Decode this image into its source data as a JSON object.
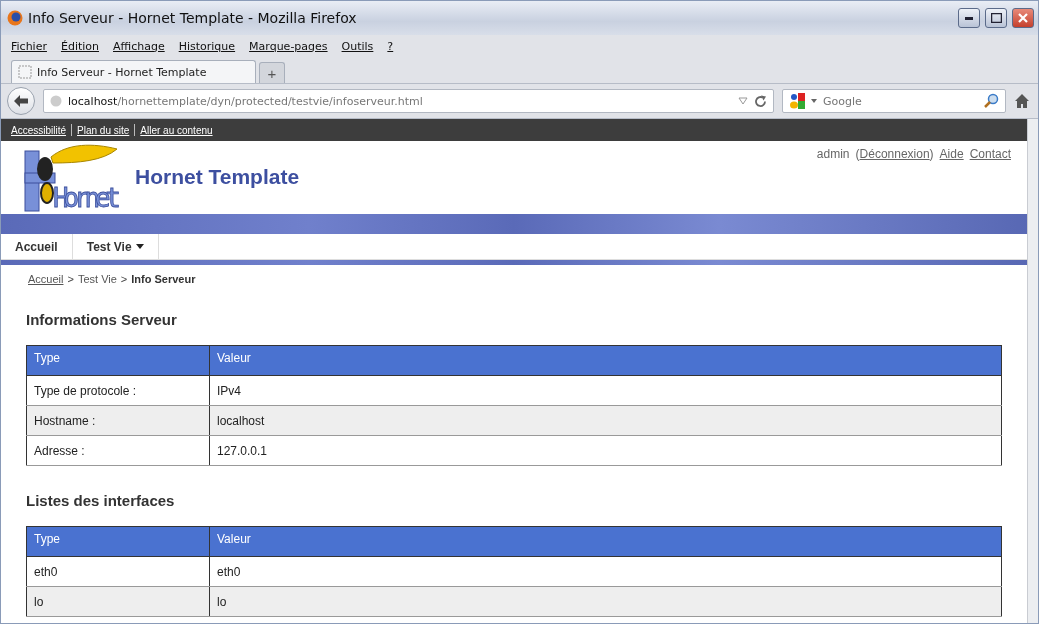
{
  "window": {
    "title": "Info Serveur - Hornet Template - Mozilla Firefox"
  },
  "menu": [
    "Fichier",
    "Édition",
    "Affichage",
    "Historique",
    "Marque-pages",
    "Outils",
    "?"
  ],
  "tabs": [
    {
      "label": "Info Serveur - Hornet Template",
      "selected": true
    }
  ],
  "new_tab": "+",
  "address": {
    "host": "localhost",
    "path": "/hornettemplate/dyn/protected/testvie/infoserveur.html"
  },
  "search": {
    "placeholder": "Google"
  },
  "skip_links": [
    "Accessibilité",
    "Plan du site",
    "Aller au contenu"
  ],
  "header": {
    "logo_text": "Hornet",
    "site_title": "Hornet Template",
    "user": "admin",
    "user_links": [
      {
        "label": "Déconnexion",
        "kind": "paren",
        "open": "(",
        "close": ")"
      },
      {
        "label": "Aide",
        "kind": "plain"
      },
      {
        "label": "Contact",
        "kind": "plain"
      }
    ]
  },
  "nav": [
    {
      "label": "Accueil",
      "dropdown": false
    },
    {
      "label": "Test Vie",
      "dropdown": true
    }
  ],
  "breadcrumb_separator": ">",
  "breadcrumb": [
    {
      "label": "Accueil",
      "kind": "link"
    },
    {
      "label": "Test Vie",
      "kind": "text"
    },
    {
      "label": "Info Serveur",
      "kind": "current"
    }
  ],
  "sections": [
    {
      "title": "Informations Serveur",
      "columns": [
        "Type",
        "Valeur"
      ],
      "rows": [
        [
          "Type de protocole :",
          "IPv4"
        ],
        [
          "Hostname :",
          "localhost"
        ],
        [
          "Adresse :",
          "127.0.0.1"
        ]
      ]
    },
    {
      "title": "Listes des interfaces",
      "columns": [
        "Type",
        "Valeur"
      ],
      "rows": [
        [
          "eth0",
          "eth0"
        ],
        [
          "lo",
          "lo"
        ]
      ]
    }
  ]
}
